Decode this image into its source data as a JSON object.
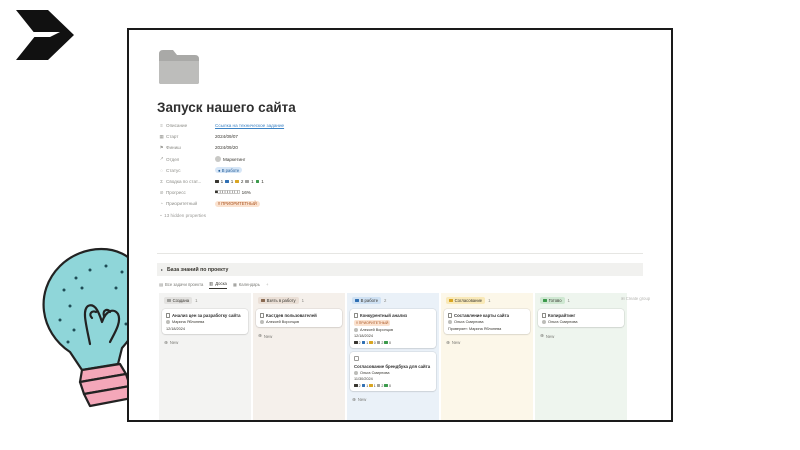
{
  "page": {
    "title": "Запуск нашего сайта",
    "folder_icon": "folder-icon"
  },
  "properties": {
    "description": {
      "icon": "description-icon",
      "label": "Описание",
      "value": "Ссылка на техническое задание"
    },
    "start": {
      "icon": "calendar-icon",
      "label": "Старт",
      "value": "2024/09/07"
    },
    "finish": {
      "icon": "flag-icon",
      "label": "Финиш",
      "value": "2024/09/20"
    },
    "department": {
      "icon": "person-icon",
      "label": "Отдел",
      "value": "Маркетинг"
    },
    "status": {
      "icon": "status-icon",
      "label": "Статус",
      "value": "В работе"
    },
    "task_summary": {
      "icon": "summary-icon",
      "label": "Сводка по стат...",
      "counts": [
        "1",
        "1",
        "2",
        "1",
        "1"
      ]
    },
    "progress": {
      "icon": "progress-icon",
      "label": "Прогресс",
      "value": "16%",
      "fraction": 0.16
    },
    "priority": {
      "icon": "priority-icon",
      "label": "Приоритетный",
      "value": "‼ ПРИОРИТЕТНЫЙ"
    },
    "hidden": {
      "label": "13 hidden properties"
    }
  },
  "database": {
    "title": "База знаний по проекту",
    "views": [
      {
        "label": "Все задачи проекта",
        "icon": "table-view-icon"
      },
      {
        "label": "Доска",
        "icon": "board-view-icon"
      },
      {
        "label": "Календарь",
        "icon": "calendar-view-icon"
      }
    ],
    "add_view": "+",
    "columns": [
      {
        "name": "Создана",
        "count": "1",
        "bg": "#f3f3f2",
        "tag": "#e3e2e0"
      },
      {
        "name": "Взять в работу",
        "count": "1",
        "bg": "#f5f0eb",
        "tag": "#eadfd6"
      },
      {
        "name": "В работе",
        "count": "2",
        "bg": "#eaf1f8",
        "tag": "#cfe1f3"
      },
      {
        "name": "Согласование",
        "count": "1",
        "bg": "#fcf7e9",
        "tag": "#f9e9b8"
      },
      {
        "name": "Готово",
        "count": "1",
        "bg": "#eef5ee",
        "tag": "#cfe8d2"
      }
    ],
    "create_group": "Create group",
    "new_label": "New",
    "cards": {
      "c0": {
        "title": "Анализ цен за разработку сайта",
        "person": "Марина Яблонева",
        "date": "12/18/2024"
      },
      "c1": {
        "title": "Кастдев пользователей",
        "person": "Алексей Воронцов"
      },
      "c2a": {
        "title": "Конкурентный анализ",
        "badge": "‼ ПРИОРИТЕТНЫЙ",
        "person": "Алексей Воронцов",
        "date": "12/18/2024",
        "counts": [
          "2",
          "1",
          "0",
          "2",
          "0"
        ]
      },
      "c2b": {
        "title": "Согласование брендбука для сайта",
        "person": "Ольга Смирнова",
        "date": "11/30/2024",
        "counts": [
          "2",
          "1",
          "1",
          "2",
          "0"
        ]
      },
      "c3": {
        "title": "Составление карты сайта",
        "person": "Ольга Смирнова",
        "approver": "Проверяет: Марина Яблонева"
      },
      "c4": {
        "title": "Копирайтинг",
        "person": "Ольга Смирнова"
      }
    },
    "summary_colors": [
      "#37352f",
      "#2f6fb3",
      "#d9a521",
      "#a0a09d",
      "#3c9a4c"
    ]
  },
  "decor": {
    "logo": "arrow-logo",
    "bulb": "lightbulb-illustration"
  }
}
